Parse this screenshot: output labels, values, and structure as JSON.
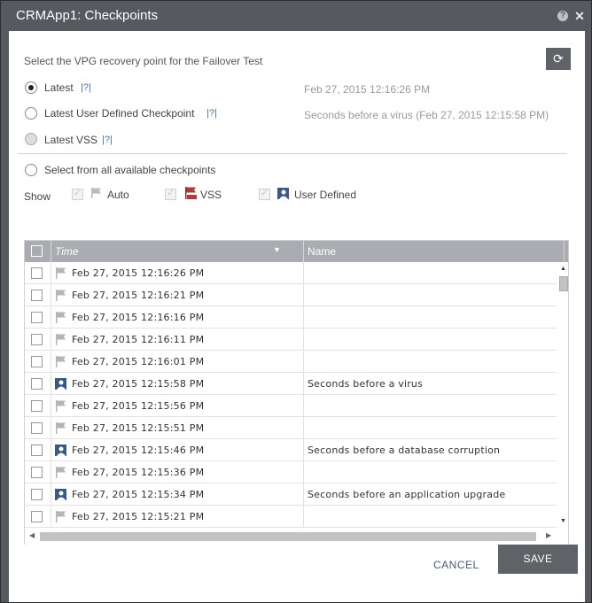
{
  "window": {
    "title": "CRMApp1: Checkpoints",
    "help_icon": "?",
    "close_icon": "✕"
  },
  "instruction": "Select the VPG recovery point for the Failover Test",
  "refresh_icon": "refresh-icon",
  "options": {
    "latest": {
      "label": "Latest",
      "help": "|?|",
      "value": "Feb 27, 2015 12:16:26 PM",
      "selected": true
    },
    "latest_user_defined": {
      "label": "Latest User Defined Checkpoint",
      "help": "|?|",
      "value": "Seconds before a virus (Feb 27, 2015 12:15:58 PM)"
    },
    "latest_vss": {
      "label": "Latest VSS",
      "help": "|?|"
    },
    "select_all": {
      "label": "Select from all available checkpoints"
    }
  },
  "show": {
    "label": "Show",
    "auto": "Auto",
    "vss": "VSS",
    "user_defined": "User Defined"
  },
  "grid": {
    "columns": {
      "time": "Time",
      "name": "Name"
    },
    "rows": [
      {
        "type": "auto",
        "time": "Feb 27, 2015 12:16:26 PM",
        "name": ""
      },
      {
        "type": "auto",
        "time": "Feb 27, 2015 12:16:21 PM",
        "name": ""
      },
      {
        "type": "auto",
        "time": "Feb 27, 2015 12:16:16 PM",
        "name": ""
      },
      {
        "type": "auto",
        "time": "Feb 27, 2015 12:16:11 PM",
        "name": ""
      },
      {
        "type": "auto",
        "time": "Feb 27, 2015 12:16:01 PM",
        "name": ""
      },
      {
        "type": "user",
        "time": "Feb 27, 2015 12:15:58 PM",
        "name": "Seconds before a virus"
      },
      {
        "type": "auto",
        "time": "Feb 27, 2015 12:15:56 PM",
        "name": ""
      },
      {
        "type": "auto",
        "time": "Feb 27, 2015 12:15:51 PM",
        "name": ""
      },
      {
        "type": "user",
        "time": "Feb 27, 2015 12:15:46 PM",
        "name": "Seconds before a database corruption"
      },
      {
        "type": "auto",
        "time": "Feb 27, 2015 12:15:36 PM",
        "name": ""
      },
      {
        "type": "user",
        "time": "Feb 27, 2015 12:15:34 PM",
        "name": "Seconds before an application upgrade"
      },
      {
        "type": "auto",
        "time": "Feb 27, 2015 12:15:21 PM",
        "name": ""
      }
    ]
  },
  "buttons": {
    "cancel": "CANCEL",
    "save": "SAVE"
  },
  "colors": {
    "title_bar": "#56595e",
    "header": "#a9acb1",
    "button": "#5f6368",
    "link": "#4a6ea9"
  }
}
